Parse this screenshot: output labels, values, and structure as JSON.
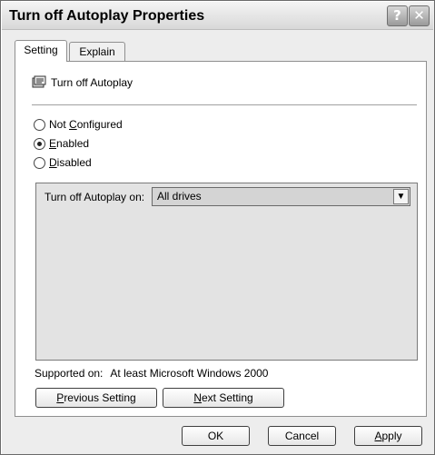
{
  "window": {
    "title": "Turn off Autoplay Properties",
    "help_glyph": "?",
    "close_glyph": "✕"
  },
  "tabs": [
    {
      "label": "Setting",
      "active": true
    },
    {
      "label": "Explain",
      "active": false
    }
  ],
  "policy": {
    "icon": "policy-settings-icon",
    "name": "Turn off Autoplay"
  },
  "radios": [
    {
      "pre": "Not ",
      "mnemonic": "C",
      "post": "onfigured",
      "checked": false
    },
    {
      "pre": "",
      "mnemonic": "E",
      "post": "nabled",
      "checked": true
    },
    {
      "pre": "",
      "mnemonic": "D",
      "post": "isabled",
      "checked": false
    }
  ],
  "options": {
    "label": "Turn off Autoplay on:",
    "selected": "All drives"
  },
  "supported": {
    "label": "Supported on:",
    "value": "At least Microsoft Windows 2000"
  },
  "nav_buttons": {
    "prev": {
      "mnemonic": "P",
      "rest": "revious Setting"
    },
    "next": {
      "mnemonic": "N",
      "rest": "ext Setting"
    }
  },
  "footer_buttons": {
    "ok": "OK",
    "cancel": "Cancel",
    "apply": {
      "mnemonic": "A",
      "rest": "pply"
    }
  }
}
